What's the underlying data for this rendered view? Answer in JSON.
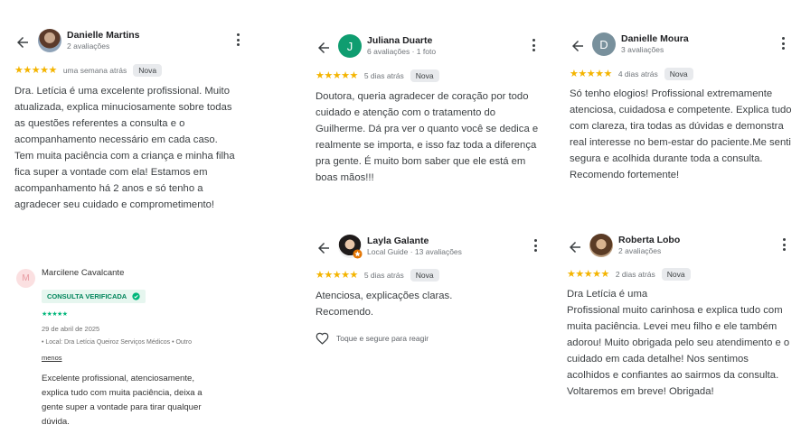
{
  "colors": {
    "star": "#f4b400",
    "trustpilot_green": "#00b67a"
  },
  "review1": {
    "name": "Danielle Martins",
    "sub": "2 avaliações",
    "avatar_icon": "avatar-photo",
    "stars": "★★★★★",
    "time": "uma semana atrás",
    "badge": "Nova",
    "text": "Dra. Letícia é uma excelente profissional. Muito\natualizada, explica minuciosamente sobre todas\nas questões referentes a consulta e o\nacompanhamento necessário em cada caso.\nTem muita paciência com a criança e minha filha\nfica super a vontade com ela! Estamos em\nacompanhamento há 2 anos e só tenho a\nagradecer seu cuidado e comprometimento!"
  },
  "review2": {
    "name": "Juliana Duarte",
    "sub": "6 avaliações · 1 foto",
    "initial": "J",
    "avatar_color": "#0f9d70",
    "stars": "★★★★★",
    "time": "5 dias atrás",
    "badge": "Nova",
    "text": "Doutora, queria agradecer de coração por todo\ncuidado e atenção com o tratamento do\nGuilherme. Dá pra ver o quanto você se dedica e\nrealmente se importa, e isso faz toda a diferença\npra gente. É muito bom saber que ele está em\nboas mãos!!!"
  },
  "review3": {
    "name": "Danielle Moura",
    "sub": "3 avaliações",
    "initial": "D",
    "avatar_color": "#78909c",
    "stars": "★★★★★",
    "time": "4 dias atrás",
    "badge": "Nova",
    "text": "Só tenho elogios! Profissional extremamente\natenciosa, cuidadosa e competente. Explica tudo\ncom clareza, tira todas as dúvidas e demonstra\nreal interesse no bem-estar do paciente.Me senti\nsegura e acolhida durante toda a consulta.\nRecomendo fortemente!"
  },
  "review4": {
    "name": "Marcilene Cavalcante",
    "initial": "M",
    "verified": "CONSULTA VERIFICADA",
    "stars": "★★★★★",
    "date": "29 de abril de 2025",
    "local": "• Local: Dra Letícia Queiroz Serviços Médicos • Outro",
    "less": "menos",
    "text": "Excelente profissional, atenciosamente,\nexplica tudo com muita paciência, deixa a\ngente super a vontade para tirar qualquer\ndúvida."
  },
  "review5": {
    "name": "Layla Galante",
    "sub": "Local Guide · 13 avaliações",
    "stars": "★★★★★",
    "time": "5 dias atrás",
    "badge": "Nova",
    "text": "Atenciosa, explicações claras.\nRecomendo.",
    "react": "Toque e segure para reagir"
  },
  "review6": {
    "name": "Roberta Lobo",
    "sub": "2 avaliações",
    "stars": "★★★★★",
    "time": "2 dias atrás",
    "badge": "Nova",
    "text": "Dra Letícia é uma\nProfissional muito carinhosa e explica tudo com\nmuita paciência. Levei meu filho e ele também\nadorou! Muito obrigada pelo seu atendimento e o\ncuidado em cada detalhe! Nos sentimos\nacolhidos e confiantes ao sairmos da consulta.\nVoltaremos em breve! Obrigada!"
  }
}
